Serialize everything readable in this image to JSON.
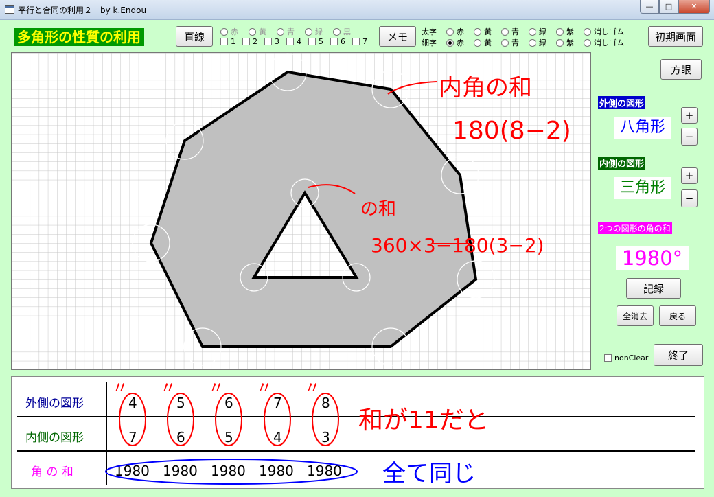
{
  "window": {
    "title": "平行と合同の利用２　by k.Endou",
    "min_glyph": "—",
    "max_glyph": "□",
    "close_glyph": "✕"
  },
  "toolbar": {
    "app_title": "多角形の性質の利用",
    "line_button": "直線",
    "memo_button": "メモ",
    "reset_button": "初期画面",
    "grid_button": "方眼",
    "line_colors": [
      "赤",
      "黄",
      "青",
      "緑",
      "黒"
    ],
    "line_checks": [
      "1",
      "2",
      "3",
      "4",
      "5",
      "6",
      "7"
    ],
    "thick_label": "太字",
    "thin_label": "細字",
    "pen_colors": [
      "赤",
      "黄",
      "青",
      "緑",
      "紫"
    ],
    "eraser": "消しゴム"
  },
  "side": {
    "outer_label": "外側の図形",
    "outer_shape": "八角形",
    "inner_label": "内側の図形",
    "inner_shape": "三角形",
    "plus": "+",
    "minus": "−",
    "sum_label": "2つの図形の角の和",
    "sum_value": "1980°",
    "record_button": "記録",
    "clear_all_button": "全消去",
    "back_button": "戻る",
    "nonclear_label": "nonClear",
    "exit_button": "終了"
  },
  "annotations": {
    "interior_sum": "内角の和",
    "formula_outer": "180(8−2)",
    "inner_sum": "の和",
    "formula_inner": "360×3−180(3−2)",
    "ditto": "〃",
    "sum_is_11": "和が11だと",
    "all_same": "全て同じ"
  },
  "table": {
    "outer_label": "外側の図形",
    "inner_label": "内側の図形",
    "sum_label": "角 の 和",
    "outer_values": [
      "4",
      "5",
      "6",
      "7",
      "8"
    ],
    "inner_values": [
      "7",
      "6",
      "5",
      "4",
      "3"
    ],
    "sum_values": [
      "1980",
      "1980",
      "1980",
      "1980",
      "1980"
    ]
  },
  "colors": {
    "background": "#ccffcc",
    "title_bg": "#009900",
    "title_fg": "#ffff00",
    "outer_label_bg": "#0000cc",
    "inner_label_bg": "#006600",
    "sum_label_bg": "#ff00ff",
    "outer_shape_fg": "#0000ff",
    "inner_shape_fg": "#008000",
    "shape_fill": "#c0c0c0",
    "annotation_red": "#ff0000",
    "annotation_blue": "#0000ff"
  }
}
